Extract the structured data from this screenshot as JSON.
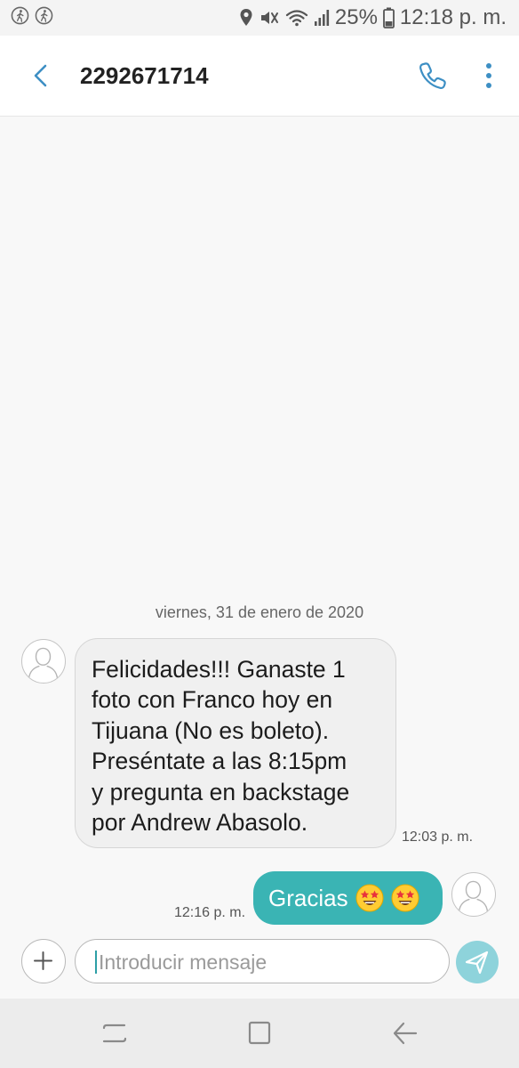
{
  "status_bar": {
    "left_icons": [
      "walking-activity-icon",
      "walking-activity-icon"
    ],
    "right_icons": [
      "location-icon",
      "mute-vibrate-icon",
      "wifi-icon",
      "signal-icon",
      "battery-icon"
    ],
    "battery_percent": "25%",
    "time": "12:18 p. m."
  },
  "header": {
    "title": "2292671714",
    "back_icon": "chevron-left-icon",
    "call_icon": "phone-icon",
    "more_icon": "more-vertical-icon"
  },
  "conversation": {
    "date_divider": "viernes, 31 de enero de 2020",
    "messages": [
      {
        "direction": "incoming",
        "lines": [
          "Felicidades!!! Ganaste 1",
          "foto con Franco hoy en",
          "Tijuana (No es boleto).",
          "Preséntate a las 8:15pm",
          "y pregunta en backstage",
          "por Andrew Abasolo."
        ],
        "time": "12:03 p. m."
      },
      {
        "direction": "outgoing",
        "text": "Gracias",
        "emojis": [
          "star-struck-emoji",
          "star-struck-emoji"
        ],
        "time": "12:16 p. m."
      }
    ]
  },
  "composer": {
    "placeholder": "Introducir mensaje",
    "add_icon": "plus-icon",
    "send_icon": "send-icon"
  },
  "nav_bar": {
    "items": [
      "recent-apps-icon",
      "home-icon",
      "back-icon"
    ]
  },
  "colors": {
    "accent": "#3ab4b4",
    "send_button": "#8ed3db",
    "header_icons": "#3d8fc4",
    "background": "#f8f8f8"
  }
}
